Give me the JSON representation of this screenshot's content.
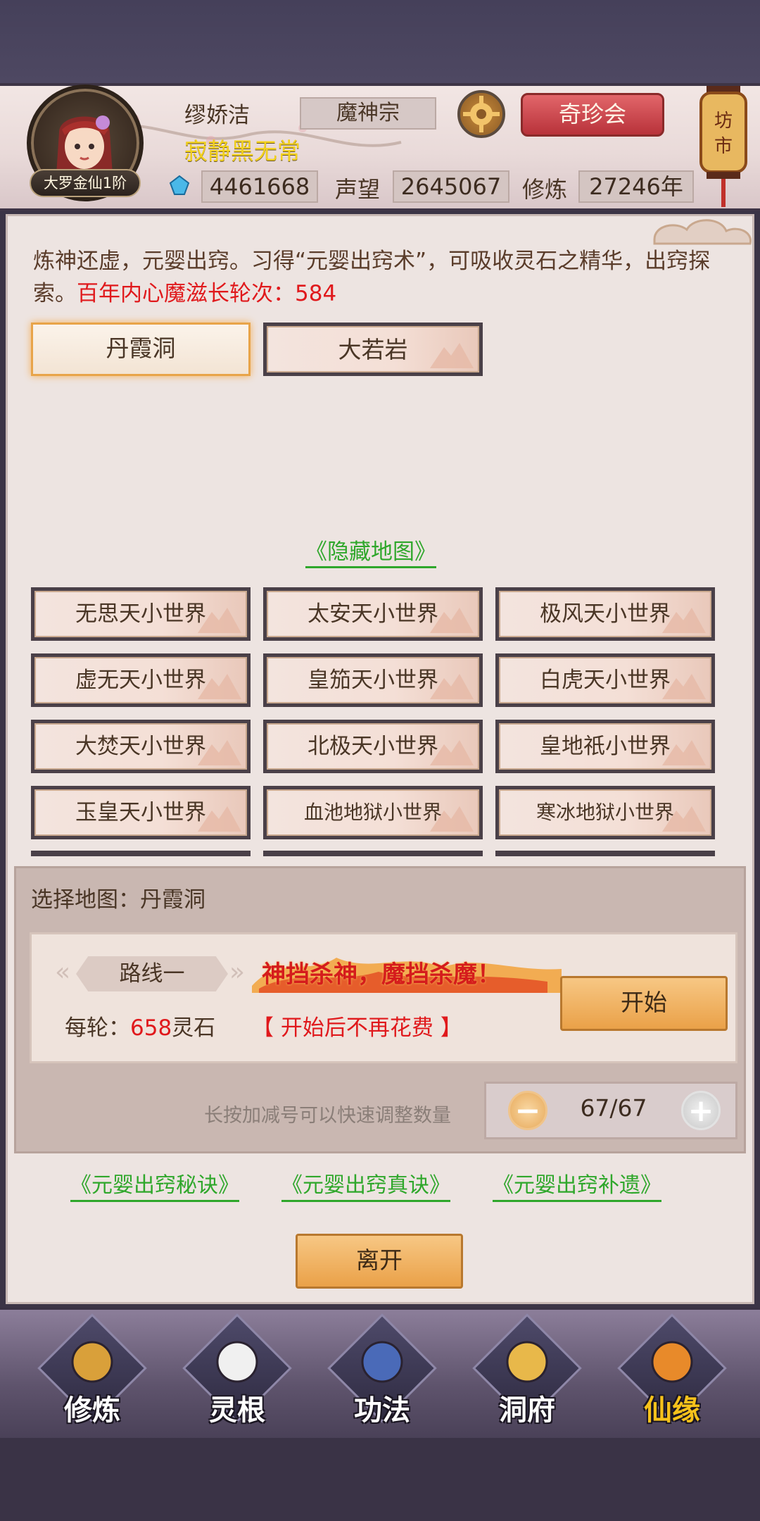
{
  "header": {
    "player_name": "缪娇洁",
    "player_title": "寂静黑无常",
    "rank": "大罗金仙1阶",
    "sect": "魔神宗",
    "treasure_button": "奇珍会",
    "market_label": "坊市",
    "spirit_stones": "4461668",
    "reputation_label": "声望",
    "reputation": "2645067",
    "cultivation_label": "修炼",
    "cultivation": "27246年"
  },
  "intro": {
    "text": "炼神还虚，元婴出窍。习得“元婴出窍术”，可吸收灵石之精华，出窍探索。",
    "highlight": "百年内心魔滋长轮次：584"
  },
  "tabs": [
    {
      "label": "丹霞洞",
      "active": true
    },
    {
      "label": "大若岩",
      "active": false
    }
  ],
  "hidden_map_link": "《隐藏地图》",
  "maps": [
    "无思天小世界",
    "太安天小世界",
    "极风天小世界",
    "虚无天小世界",
    "皇笳天小世界",
    "白虎天小世界",
    "大焚天小世界",
    "北极天小世界",
    "皇地祇小世界",
    "玉皇天小世界",
    "血池地狱小世界",
    "寒冰地狱小世界"
  ],
  "selection": {
    "label": "选择地图：丹霞洞",
    "route": "路线一",
    "slogan": "神挡杀神，魔挡杀魔！",
    "cost_prefix": "每轮：",
    "cost_value": "658",
    "cost_suffix": "灵石",
    "cost_note": "【 开始后不再花费 】",
    "start_button": "开始",
    "hint": "长按加减号可以快速调整数量",
    "minus": "−",
    "plus": "+",
    "count": "67/67"
  },
  "links": [
    "《元婴出窍秘诀》",
    "《元婴出窍真诀》",
    "《元婴出窍补遗》"
  ],
  "leave_button": "离开",
  "nav": [
    {
      "label": "修炼",
      "icon": "cultivate-icon"
    },
    {
      "label": "灵根",
      "icon": "spirit-root-icon"
    },
    {
      "label": "功法",
      "icon": "technique-book-icon"
    },
    {
      "label": "洞府",
      "icon": "cave-house-icon"
    },
    {
      "label": "仙缘",
      "icon": "gourd-icon"
    }
  ],
  "colors": {
    "accent_red": "#e0191c",
    "link_green": "#2fa72b",
    "title_yellow": "#f3d21e",
    "button_orange": "#eaa148"
  }
}
